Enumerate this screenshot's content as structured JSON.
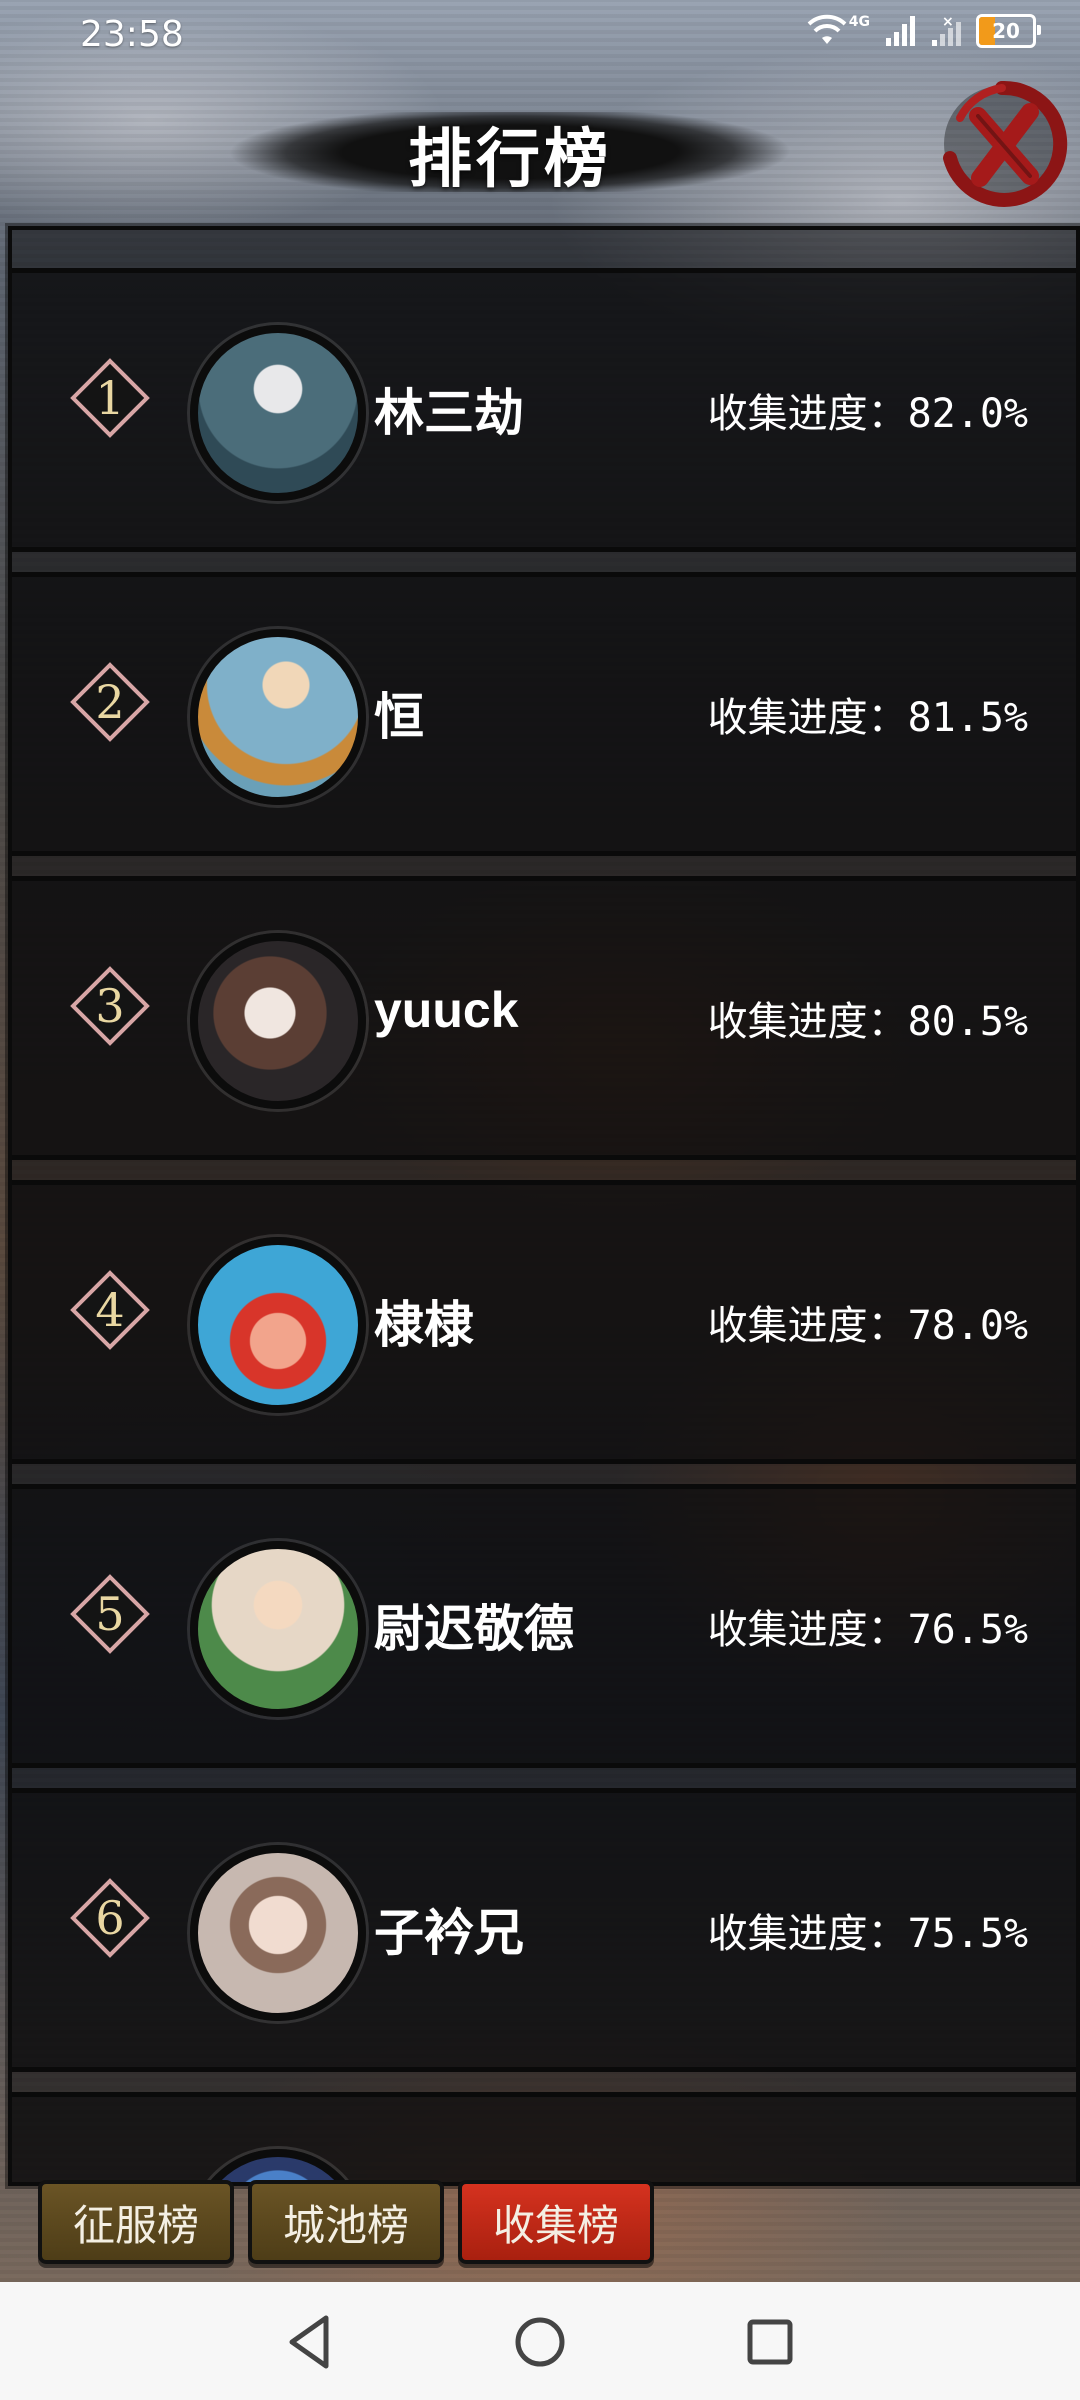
{
  "status_bar": {
    "time": "23:58",
    "network": "4G",
    "battery": "20",
    "icons": [
      "wifi-icon",
      "signal-icon",
      "signal-icon-2",
      "battery-icon"
    ]
  },
  "header": {
    "title": "排行榜",
    "close_icon": "close-icon"
  },
  "leaderboard": {
    "rows": [
      {
        "rank": "1",
        "name": "林三劫",
        "progress": "收集进度：82.0%",
        "avatar_color": "#4b6d7a"
      },
      {
        "rank": "2",
        "name": "恒",
        "progress": "收集进度：81.5%",
        "avatar_color": "#7fb0c9"
      },
      {
        "rank": "3",
        "name": "yuuck",
        "progress": "收集进度：80.5%",
        "avatar_color": "#3b3436"
      },
      {
        "rank": "4",
        "name": "棣棣",
        "progress": "收集进度：78.0%",
        "avatar_color": "#3ea6d6"
      },
      {
        "rank": "5",
        "name": "尉迟敬德",
        "progress": "收集进度：76.5%",
        "avatar_color": "#e6d7c6"
      },
      {
        "rank": "6",
        "name": "子衿兄",
        "progress": "收集进度：75.5%",
        "avatar_color": "#c7b8b0"
      }
    ]
  },
  "tabs": [
    {
      "label": "征服榜",
      "active": false
    },
    {
      "label": "城池榜",
      "active": false
    },
    {
      "label": "收集榜",
      "active": true
    }
  ],
  "navbar": {
    "icons": [
      "back-icon",
      "home-icon",
      "recent-apps-icon"
    ]
  },
  "colors": {
    "active_tab": "#c22a17",
    "inactive_tab": "#5b4a1f",
    "rank_text": "#e9d7a2",
    "close_red": "#9e1b1b"
  }
}
